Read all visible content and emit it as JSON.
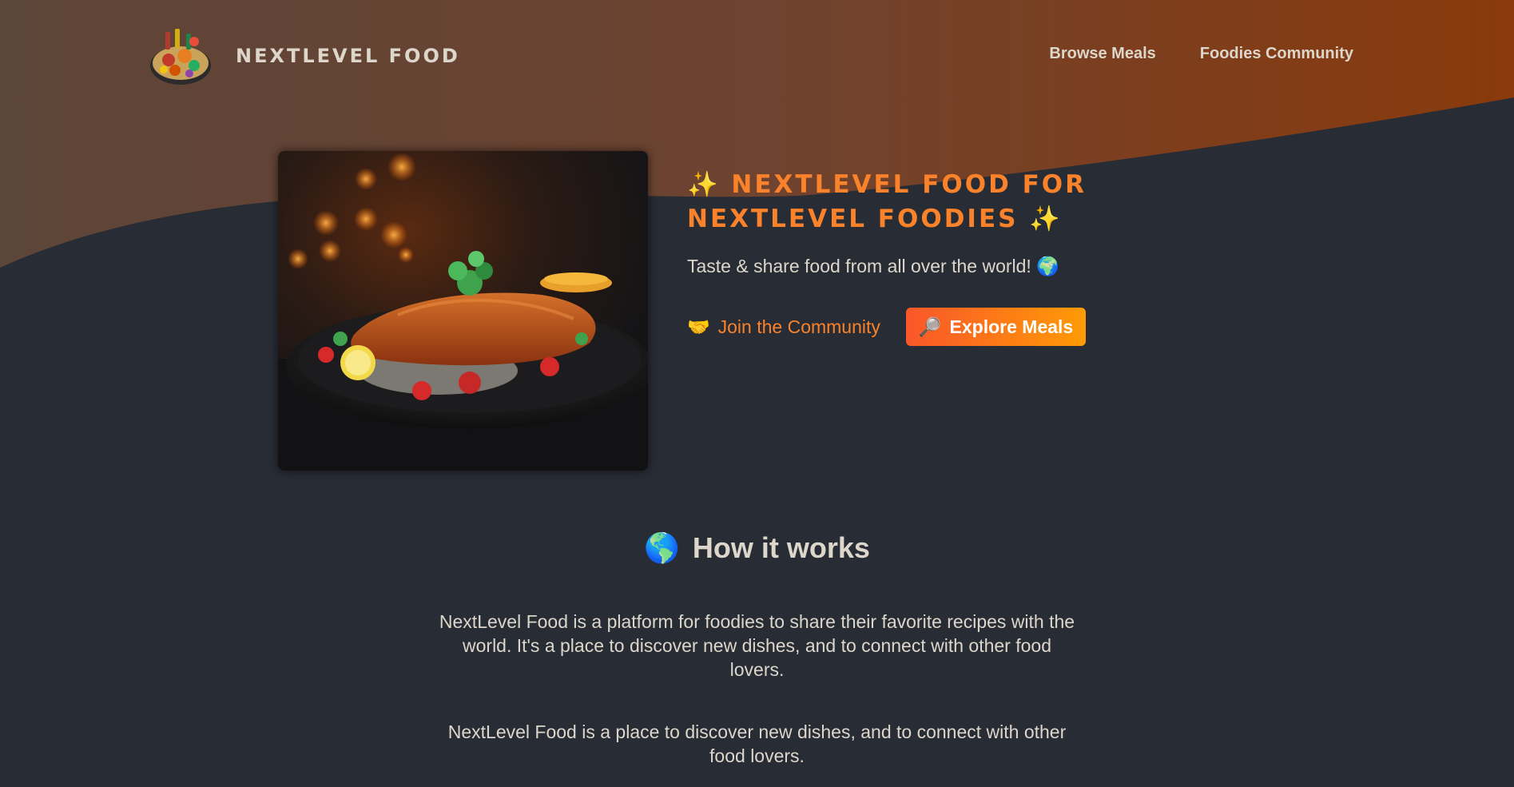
{
  "header": {
    "logo_text": "NEXTLEVEL FOOD",
    "logo_icon": "food-plate-logo",
    "nav": [
      {
        "label": "Browse Meals"
      },
      {
        "label": "Foodies Community"
      }
    ]
  },
  "hero": {
    "title_line1": "NEXTLEVEL FOOD FOR",
    "title_line2": "NEXTLEVEL FOODIES",
    "title_emoji": "✨",
    "subtitle": "Taste & share food from all over the world!",
    "subtitle_emoji": "🌍",
    "community_emoji": "🤝",
    "community_label": "Join the Community",
    "explore_emoji": "🔎",
    "explore_label": "Explore Meals",
    "image_icon": "schnitzel-image"
  },
  "how": {
    "heading_emoji": "🌎",
    "heading": "How it works",
    "p1": "NextLevel Food is a platform for foodies to share their favorite recipes with the world. It's a place to discover new dishes, and to connect with other food lovers.",
    "p2": "NextLevel Food is a place to discover new dishes, and to connect with other food lovers."
  },
  "colors": {
    "background": "#282c34",
    "accent": "#f9822a",
    "button_start": "#f9572a",
    "button_end": "#ff9b05",
    "text": "#ddd6cb"
  }
}
